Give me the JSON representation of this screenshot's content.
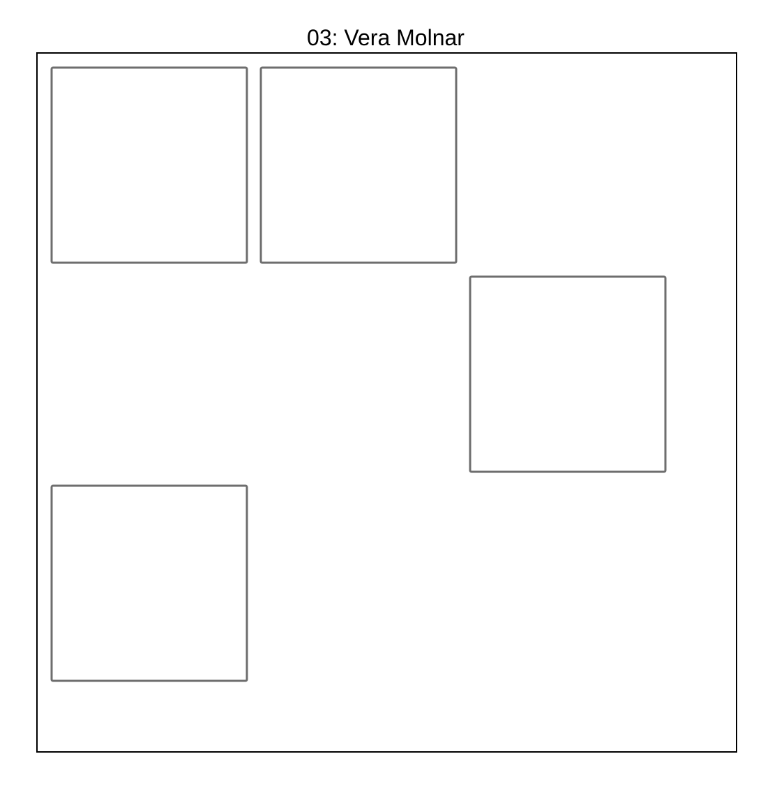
{
  "title": "03: Vera Molnar",
  "grid": {
    "rows": 3,
    "cols": 3,
    "filled": [
      [
        true,
        true,
        false
      ],
      [
        false,
        false,
        true
      ],
      [
        true,
        false,
        false
      ]
    ]
  },
  "colors": {
    "background": "#ffffff",
    "frame": "#000000",
    "square_stroke": "#6e6e6e"
  }
}
